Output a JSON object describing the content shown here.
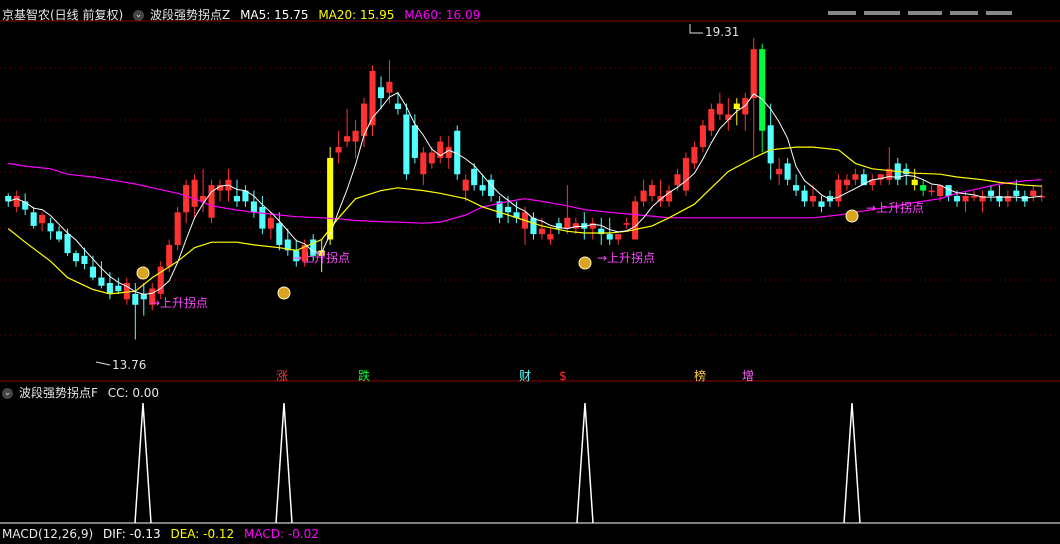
{
  "main_header": {
    "stock": "京基智农(日线 前复权)",
    "indicator": "波段强势拐点Z",
    "ma5": "MA5: 15.75",
    "ma20": "MA20: 15.95",
    "ma60": "MA60: 16.09"
  },
  "sub_header": {
    "indicator": "波段强势拐点F",
    "cc": "CC: 0.00"
  },
  "macd_header": {
    "title": "MACD(12,26,9)",
    "dif": "DIF: -0.13",
    "dea": "DEA: -0.12",
    "macd": "MACD: -0.02"
  },
  "annotations": {
    "high_label": "19.31",
    "low_label": "13.76",
    "signal_text": "→上升拐点",
    "events": [
      "涨",
      "跌",
      "财",
      "$",
      "榜",
      "增"
    ]
  },
  "colors": {
    "up": "#ff3232",
    "down": "#54ffff",
    "ma5": "#ffffff",
    "ma20": "#ffff00",
    "ma60": "#ff00ff",
    "signal": "#ff44ff",
    "grid": "#8b0000"
  },
  "chart_data": {
    "type": "candlestick",
    "price_range": [
      13.2,
      19.6
    ],
    "candles": [
      [
        16.4,
        16.45,
        16.2,
        16.3
      ],
      [
        16.2,
        16.5,
        16.1,
        16.4
      ],
      [
        16.3,
        16.45,
        16.05,
        16.15
      ],
      [
        16.1,
        16.2,
        15.8,
        15.85
      ],
      [
        15.9,
        16.1,
        15.75,
        16.05
      ],
      [
        15.9,
        16.0,
        15.6,
        15.75
      ],
      [
        15.75,
        15.85,
        15.55,
        15.6
      ],
      [
        15.7,
        15.8,
        15.3,
        15.35
      ],
      [
        15.35,
        15.4,
        15.1,
        15.2
      ],
      [
        15.3,
        15.45,
        15.05,
        15.15
      ],
      [
        15.1,
        15.3,
        14.85,
        14.9
      ],
      [
        14.9,
        15.2,
        14.7,
        14.75
      ],
      [
        14.8,
        15.0,
        14.5,
        14.6
      ],
      [
        14.75,
        14.9,
        14.6,
        14.65
      ],
      [
        14.5,
        14.9,
        14.4,
        14.8
      ],
      [
        14.6,
        14.8,
        13.76,
        14.4
      ],
      [
        14.6,
        14.8,
        14.2,
        14.5
      ],
      [
        14.4,
        14.8,
        14.3,
        14.7
      ],
      [
        14.6,
        15.2,
        14.5,
        15.1
      ],
      [
        15.1,
        15.6,
        15.0,
        15.5
      ],
      [
        15.5,
        16.2,
        15.4,
        16.1
      ],
      [
        16.1,
        16.7,
        15.9,
        16.6
      ],
      [
        16.2,
        16.8,
        16.0,
        16.7
      ],
      [
        16.3,
        16.9,
        16.1,
        16.4
      ],
      [
        16.0,
        16.7,
        15.9,
        16.6
      ],
      [
        16.5,
        16.7,
        16.3,
        16.6
      ],
      [
        16.5,
        16.9,
        16.3,
        16.7
      ],
      [
        16.4,
        16.7,
        16.2,
        16.3
      ],
      [
        16.5,
        16.6,
        16.2,
        16.3
      ],
      [
        16.3,
        16.5,
        16.0,
        16.1
      ],
      [
        16.2,
        16.4,
        15.7,
        15.8
      ],
      [
        15.8,
        16.1,
        15.6,
        16.0
      ],
      [
        15.9,
        16.1,
        15.4,
        15.5
      ],
      [
        15.6,
        15.8,
        15.3,
        15.4
      ],
      [
        15.4,
        15.6,
        15.1,
        15.2
      ],
      [
        15.2,
        15.6,
        15.1,
        15.5
      ],
      [
        15.6,
        15.7,
        15.2,
        15.3
      ],
      [
        15.3,
        15.6,
        15.0,
        15.4
      ],
      [
        15.6,
        17.3,
        15.5,
        17.1
      ],
      [
        17.2,
        17.6,
        17.0,
        17.3
      ],
      [
        17.4,
        18.0,
        17.3,
        17.5
      ],
      [
        17.4,
        17.8,
        17.1,
        17.6
      ],
      [
        17.5,
        18.2,
        17.3,
        18.1
      ],
      [
        17.7,
        18.8,
        17.5,
        18.7
      ],
      [
        18.4,
        18.6,
        18.0,
        18.2
      ],
      [
        18.3,
        18.9,
        18.1,
        18.5
      ],
      [
        18.1,
        18.3,
        17.9,
        18.0
      ],
      [
        17.9,
        18.1,
        16.7,
        16.8
      ],
      [
        17.7,
        17.9,
        17.0,
        17.1
      ],
      [
        16.8,
        17.3,
        16.6,
        17.2
      ],
      [
        17.0,
        17.3,
        16.9,
        17.2
      ],
      [
        17.1,
        17.5,
        17.0,
        17.4
      ],
      [
        17.1,
        17.5,
        16.9,
        17.3
      ],
      [
        17.6,
        17.7,
        16.7,
        16.8
      ],
      [
        16.5,
        16.8,
        16.3,
        16.7
      ],
      [
        16.9,
        17.0,
        16.5,
        16.6
      ],
      [
        16.6,
        16.8,
        16.4,
        16.5
      ],
      [
        16.7,
        16.8,
        16.3,
        16.4
      ],
      [
        16.3,
        16.4,
        15.9,
        16.0
      ],
      [
        16.2,
        16.4,
        15.9,
        16.1
      ],
      [
        16.1,
        16.3,
        15.9,
        16.0
      ],
      [
        15.8,
        16.2,
        15.5,
        16.1
      ],
      [
        16.0,
        16.1,
        15.6,
        15.7
      ],
      [
        15.7,
        16.0,
        15.6,
        15.8
      ],
      [
        15.6,
        15.8,
        15.5,
        15.7
      ],
      [
        15.9,
        16.0,
        15.7,
        15.8
      ],
      [
        15.8,
        16.6,
        15.7,
        16.0
      ],
      [
        15.8,
        16.0,
        15.7,
        15.9
      ],
      [
        15.9,
        16.1,
        15.6,
        15.8
      ],
      [
        15.8,
        16.0,
        15.6,
        15.9
      ],
      [
        15.8,
        16.0,
        15.5,
        15.7
      ],
      [
        15.7,
        16.0,
        15.5,
        15.6
      ],
      [
        15.6,
        15.7,
        15.5,
        15.7
      ],
      [
        15.9,
        16.0,
        15.8,
        15.9
      ],
      [
        15.6,
        16.4,
        15.6,
        16.3
      ],
      [
        16.3,
        16.7,
        16.2,
        16.5
      ],
      [
        16.4,
        16.7,
        16.3,
        16.6
      ],
      [
        16.3,
        16.7,
        16.2,
        16.4
      ],
      [
        16.3,
        16.6,
        16.2,
        16.5
      ],
      [
        16.6,
        16.9,
        16.5,
        16.8
      ],
      [
        16.5,
        17.2,
        16.4,
        17.1
      ],
      [
        17.0,
        17.4,
        16.9,
        17.3
      ],
      [
        17.3,
        17.8,
        17.2,
        17.7
      ],
      [
        17.6,
        18.1,
        17.5,
        18.0
      ],
      [
        17.9,
        18.3,
        17.8,
        18.1
      ],
      [
        17.8,
        18.2,
        17.6,
        17.9
      ],
      [
        18.0,
        18.2,
        17.7,
        18.1
      ],
      [
        17.9,
        18.3,
        17.6,
        18.2
      ],
      [
        18.2,
        19.31,
        17.1,
        19.1
      ],
      [
        19.1,
        19.2,
        17.2,
        17.6
      ],
      [
        17.7,
        18.1,
        16.7,
        17.0
      ],
      [
        16.8,
        17.1,
        16.6,
        16.9
      ],
      [
        17.0,
        17.1,
        16.6,
        16.7
      ],
      [
        16.6,
        16.8,
        16.4,
        16.5
      ],
      [
        16.5,
        16.6,
        16.2,
        16.3
      ],
      [
        16.3,
        16.6,
        16.2,
        16.4
      ],
      [
        16.3,
        16.4,
        16.1,
        16.2
      ],
      [
        16.4,
        16.5,
        16.2,
        16.3
      ],
      [
        16.3,
        16.8,
        16.2,
        16.7
      ],
      [
        16.6,
        16.8,
        16.5,
        16.7
      ],
      [
        16.7,
        16.9,
        16.6,
        16.8
      ],
      [
        16.8,
        16.9,
        16.6,
        16.6
      ],
      [
        16.6,
        16.8,
        16.5,
        16.7
      ],
      [
        16.7,
        16.8,
        16.6,
        16.8
      ],
      [
        16.7,
        17.3,
        16.6,
        16.9
      ],
      [
        17.0,
        17.1,
        16.6,
        16.7
      ],
      [
        16.9,
        17.0,
        16.6,
        16.8
      ],
      [
        16.7,
        16.9,
        16.5,
        16.6
      ],
      [
        16.6,
        16.7,
        16.4,
        16.5
      ],
      [
        16.5,
        16.6,
        16.4,
        16.5
      ],
      [
        16.4,
        16.6,
        16.3,
        16.6
      ],
      [
        16.6,
        16.6,
        16.3,
        16.4
      ],
      [
        16.4,
        16.5,
        16.2,
        16.3
      ],
      [
        16.3,
        16.5,
        16.1,
        16.4
      ],
      [
        16.4,
        16.5,
        16.3,
        16.4
      ],
      [
        16.3,
        16.5,
        16.1,
        16.4
      ],
      [
        16.5,
        16.6,
        16.3,
        16.4
      ],
      [
        16.4,
        16.6,
        16.2,
        16.3
      ],
      [
        16.3,
        16.5,
        16.2,
        16.4
      ],
      [
        16.5,
        16.7,
        16.3,
        16.4
      ],
      [
        16.4,
        16.5,
        16.2,
        16.3
      ],
      [
        16.4,
        16.6,
        16.3,
        16.5
      ],
      [
        16.4,
        16.6,
        16.3,
        16.4
      ]
    ],
    "ma60": [
      17.0,
      16.95,
      16.9,
      16.8,
      16.75,
      16.7,
      16.62,
      16.55,
      16.45,
      16.35,
      16.22,
      16.14,
      16.1,
      16.05,
      16.02,
      16.0,
      15.98,
      15.95,
      15.93,
      15.92,
      15.9,
      15.92,
      16.05,
      16.2,
      16.3,
      16.35,
      16.3,
      16.22,
      16.15,
      16.1,
      16.07,
      16.03,
      16.0,
      16.0,
      16.0,
      16.0,
      16.0,
      16.0,
      16.0,
      16.0,
      16.05,
      16.1,
      16.15,
      16.22,
      16.28,
      16.35,
      16.45,
      16.55,
      16.62,
      16.68,
      16.7
    ],
    "ma20": [
      15.8,
      15.55,
      15.2,
      14.9,
      14.68,
      14.6,
      14.65,
      14.9,
      15.2,
      15.45,
      15.55,
      15.55,
      15.5,
      15.45,
      15.4,
      15.6,
      16.0,
      16.35,
      16.5,
      16.55,
      16.5,
      16.45,
      16.35,
      16.2,
      16.05,
      15.95,
      15.85,
      15.75,
      15.72,
      15.72,
      15.75,
      15.85,
      16.0,
      16.25,
      16.55,
      16.85,
      17.1,
      17.25,
      17.3,
      17.3,
      17.25,
      17.0,
      16.9,
      16.85,
      16.82,
      16.8,
      16.75,
      16.7,
      16.65,
      16.6,
      16.58
    ]
  }
}
